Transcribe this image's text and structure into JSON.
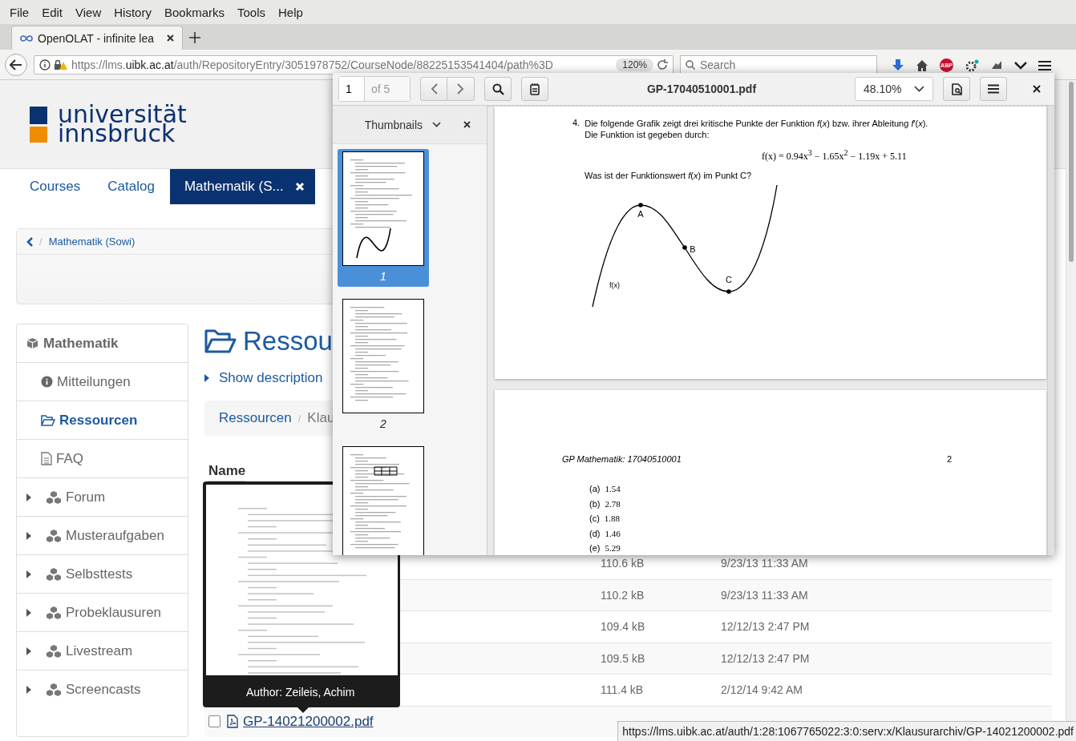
{
  "menu": [
    "File",
    "Edit",
    "View",
    "History",
    "Bookmarks",
    "Tools",
    "Help"
  ],
  "tab": {
    "title": "OpenOLAT - infinite lea"
  },
  "address": {
    "scheme": "https://lms.",
    "host": "uibk.ac.at",
    "path": "/auth/RepositoryEntry/3051978752/CourseNode/88225153541404/path%3D",
    "zoom": "120%",
    "search_placeholder": "Search",
    "adblock": "ABP"
  },
  "site": {
    "logo": [
      "universität",
      "innsbruck"
    ],
    "nav": [
      {
        "label": "Courses",
        "selected": false
      },
      {
        "label": "Catalog",
        "selected": false
      },
      {
        "label": "Mathematik (S...",
        "selected": true
      }
    ],
    "breadcrumb": {
      "separator": "/",
      "label": "Mathematik (Sowi)"
    },
    "sidebar": {
      "title": "Mathematik",
      "items": [
        {
          "label": "Mitteilungen",
          "kind": "info",
          "selected": false,
          "expandable": false
        },
        {
          "label": "Ressourcen",
          "kind": "folder",
          "selected": true,
          "expandable": false
        },
        {
          "label": "FAQ",
          "kind": "file",
          "selected": false,
          "expandable": false
        },
        {
          "label": "Forum",
          "kind": "node",
          "selected": false,
          "expandable": true
        },
        {
          "label": "Musteraufgaben",
          "kind": "node",
          "selected": false,
          "expandable": true
        },
        {
          "label": "Selbsttests",
          "kind": "node",
          "selected": false,
          "expandable": true
        },
        {
          "label": "Probeklausuren",
          "kind": "node",
          "selected": false,
          "expandable": true
        },
        {
          "label": "Livestream",
          "kind": "node",
          "selected": false,
          "expandable": true
        },
        {
          "label": "Screencasts",
          "kind": "node",
          "selected": false,
          "expandable": true
        }
      ]
    },
    "heading": "Ressou",
    "show_description": "Show description",
    "path": {
      "separator": "/",
      "items": [
        "Ressourcen",
        "Klau"
      ]
    },
    "table": {
      "column": "Name",
      "rows": [
        {
          "size": "110.6 kB",
          "date": "9/23/13 11:33 AM"
        },
        {
          "size": "110.2 kB",
          "date": "9/23/13 11:33 AM"
        },
        {
          "size": "109.4 kB",
          "date": "12/12/13 2:47 PM"
        },
        {
          "size": "109.5 kB",
          "date": "12/12/13 2:47 PM"
        },
        {
          "size": "111.4 kB",
          "date": "2/12/14 9:42 AM"
        },
        {
          "name": "GP-14021200002.pdf",
          "checked": false
        }
      ]
    }
  },
  "tooltip": {
    "text": "Author: Zeileis, Achim"
  },
  "status_url": "https://lms.uibk.ac.at/auth/1:28:1067765022:3:0:serv:x/Klausurarchiv/GP-14021200002.pdf",
  "pdf_viewer": {
    "page": "1",
    "page_count": "of 5",
    "title": "GP-17040510001.pdf",
    "zoom": "48.10%",
    "sidebar_title": "Thumbnails",
    "thumbnails": [
      {
        "label": "1",
        "selected": true
      },
      {
        "label": "2",
        "selected": false
      },
      {
        "selected": false
      }
    ],
    "page_one": {
      "number": "4.",
      "question": "Die folgende Grafik zeigt drei kritische Punkte der Funktion *f*(*x*) bzw. ihrer Ableitung *f*′(*x*).",
      "line2": "Die Funktion ist gegeben durch:",
      "formula": "f(x) = 0.94x$^{3}$ − 1.65x$^{2}$ − 1.19x + 5.11",
      "ask": "Was ist der Funktionswert *f*(*x*) im Punkt C?",
      "graph_labels": [
        "A",
        "B",
        "C",
        "f(x)"
      ]
    },
    "page_two": {
      "header": "GP Mathematik: 17040510001",
      "page_number": "2",
      "options": [
        {
          "label": "(a)",
          "value": "1.54"
        },
        {
          "label": "(b)",
          "value": "2.78"
        },
        {
          "label": "(c)",
          "value": "1.88"
        },
        {
          "label": "(d)",
          "value": "1.46"
        },
        {
          "label": "(e)",
          "value": "5.29"
        }
      ]
    }
  }
}
